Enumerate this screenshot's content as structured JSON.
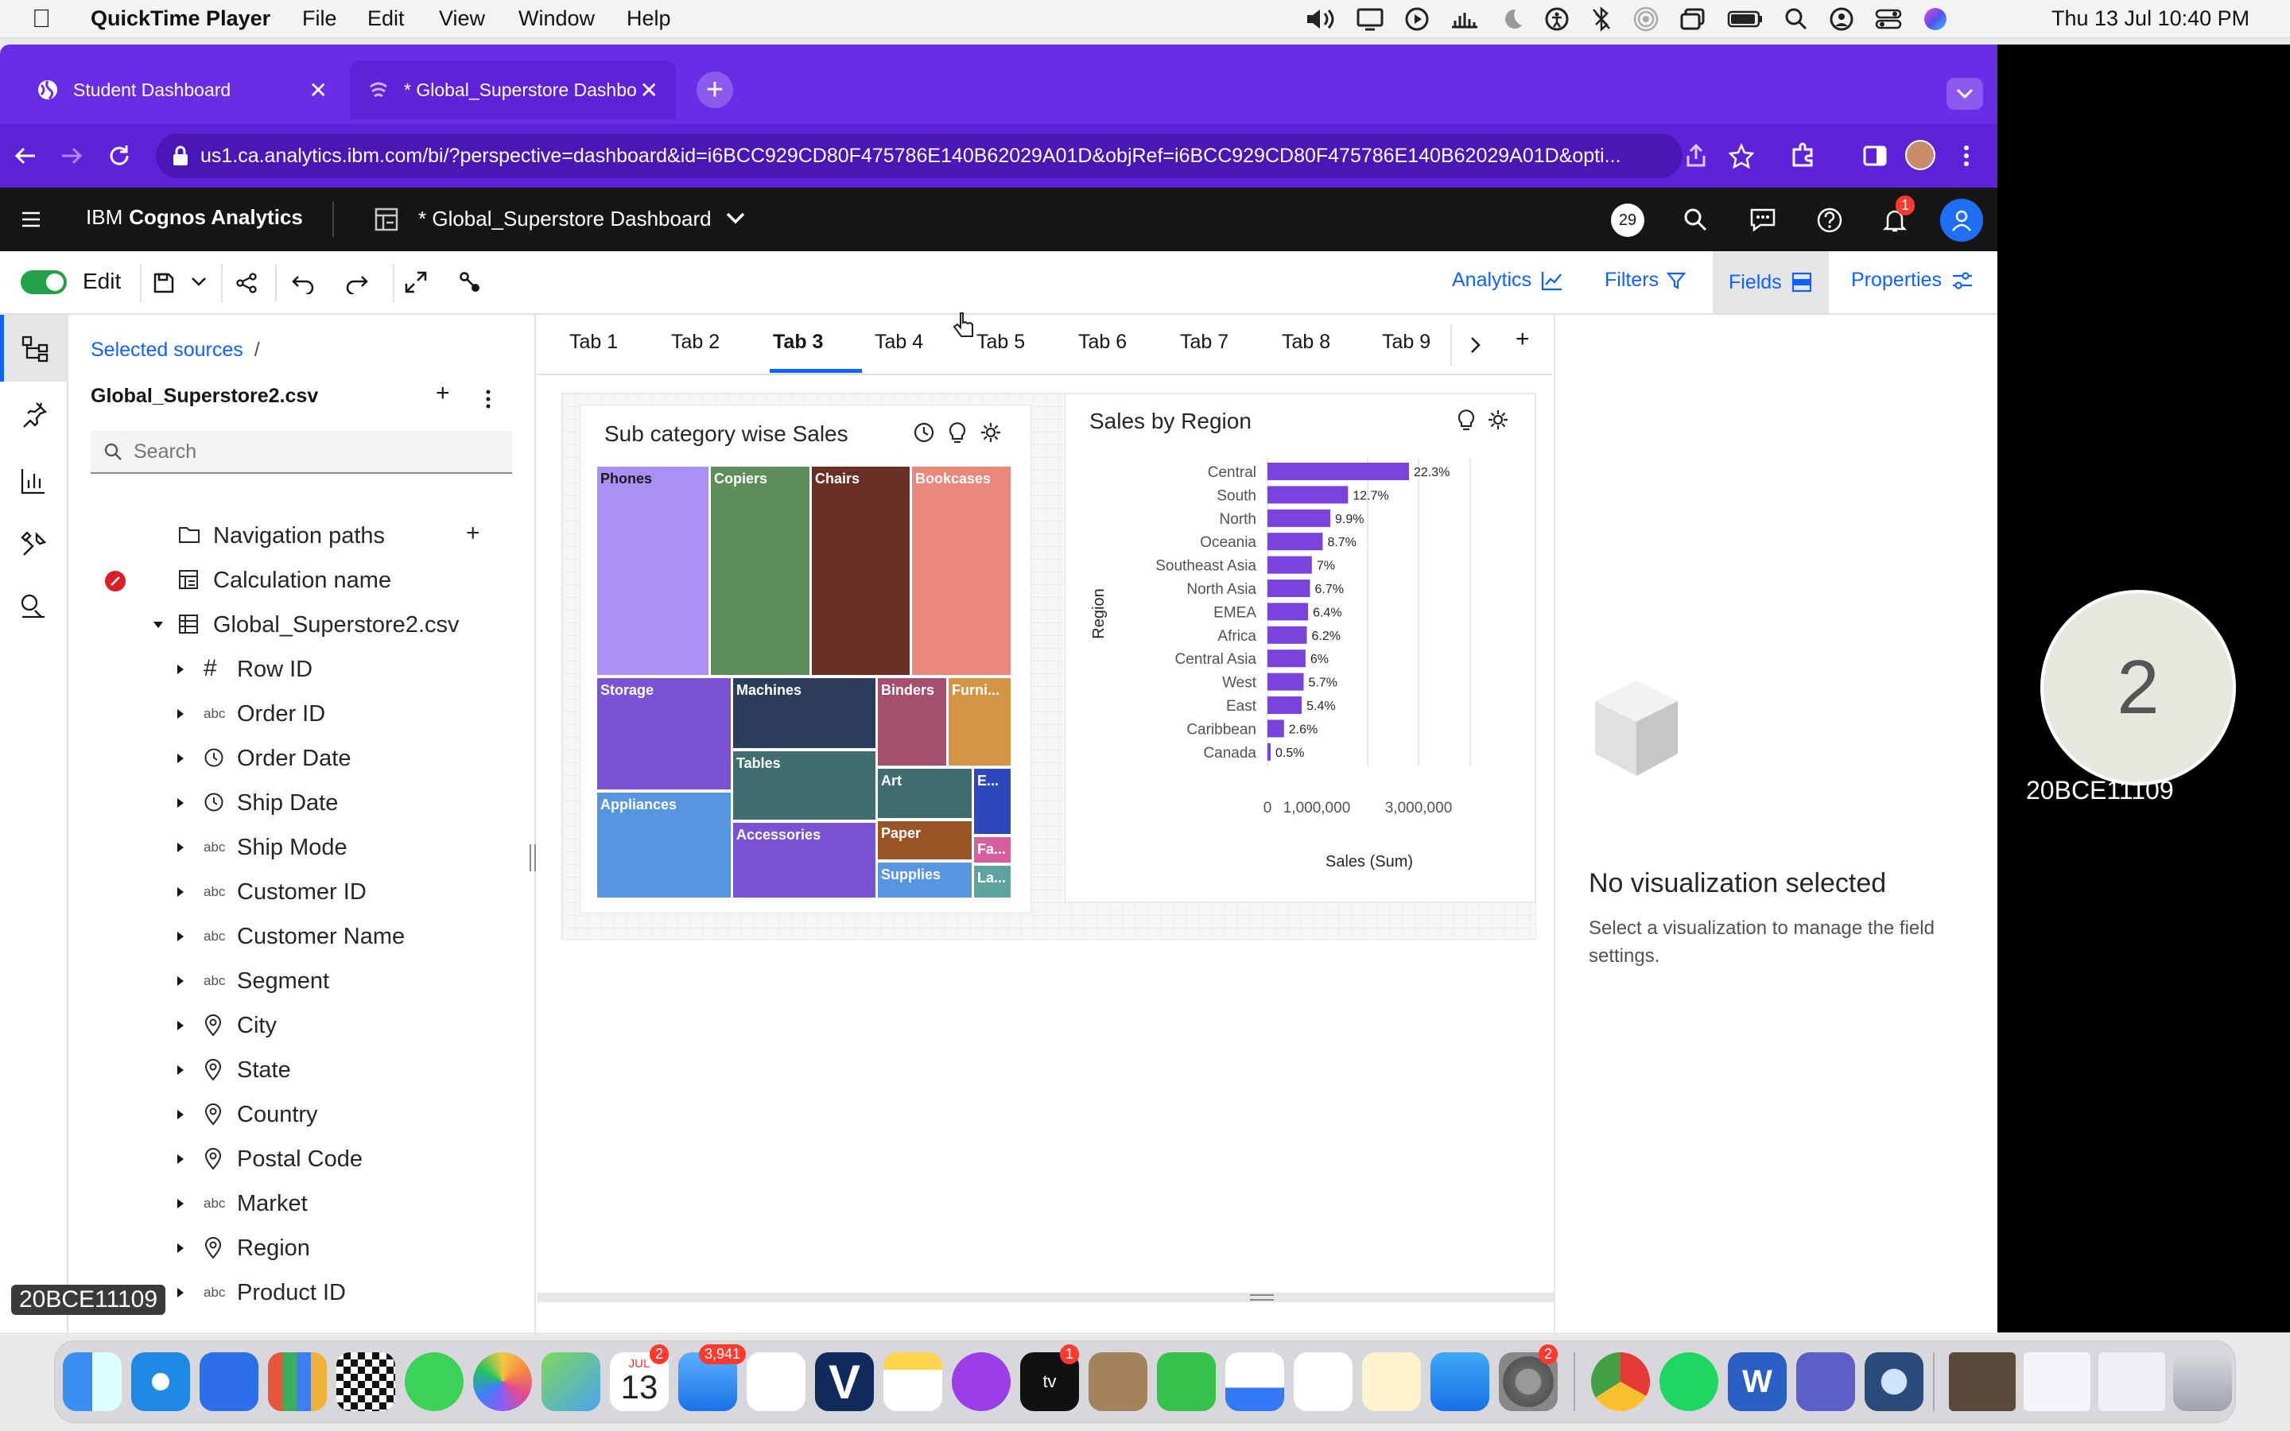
{
  "menubar": {
    "app": "QuickTime Player",
    "menus": [
      "File",
      "Edit",
      "View",
      "Window",
      "Help"
    ],
    "clock": "Thu 13 Jul  10:40 PM"
  },
  "browser": {
    "tabs": [
      {
        "title": "Student Dashboard"
      },
      {
        "title": "* Global_Superstore Dashbo"
      }
    ],
    "url": "us1.ca.analytics.ibm.com/bi/?perspective=dashboard&id=i6BCC929CD80F475786E140B62029A01D&objRef=i6BCC929CD80F475786E140B62029A01D&opti..."
  },
  "cognos": {
    "brand_prefix": "IBM",
    "brand_name": "Cognos Analytics",
    "dashboard_title": "* Global_Superstore Dashboard",
    "avatar_count": "29",
    "notif_count": "1"
  },
  "toolbar": {
    "edit_label": "Edit",
    "right_tabs": [
      "Analytics",
      "Filters",
      "Fields",
      "Properties"
    ],
    "active_right_tab": "Fields"
  },
  "datapanel": {
    "breadcrumb": "Selected sources",
    "breadcrumb_sep": "/",
    "source": "Global_Superstore2.csv",
    "search_placeholder": "Search",
    "items": [
      {
        "label": "Navigation paths",
        "type": "folder"
      },
      {
        "label": "Calculation name",
        "type": "calc"
      },
      {
        "label": "Global_Superstore2.csv",
        "type": "table"
      },
      {
        "label": "Row ID",
        "type": "hash"
      },
      {
        "label": "Order ID",
        "type": "abc"
      },
      {
        "label": "Order Date",
        "type": "clock"
      },
      {
        "label": "Ship Date",
        "type": "clock"
      },
      {
        "label": "Ship Mode",
        "type": "abc"
      },
      {
        "label": "Customer ID",
        "type": "abc"
      },
      {
        "label": "Customer Name",
        "type": "abc"
      },
      {
        "label": "Segment",
        "type": "abc"
      },
      {
        "label": "City",
        "type": "pin"
      },
      {
        "label": "State",
        "type": "pin"
      },
      {
        "label": "Country",
        "type": "pin"
      },
      {
        "label": "Postal Code",
        "type": "pin"
      },
      {
        "label": "Market",
        "type": "abc"
      },
      {
        "label": "Region",
        "type": "pin"
      },
      {
        "label": "Product ID",
        "type": "abc"
      }
    ],
    "abc": "abc",
    "hash": "#"
  },
  "canvas": {
    "tabs": [
      "Tab 1",
      "Tab 2",
      "Tab 3",
      "Tab 4",
      "Tab 5",
      "Tab 6",
      "Tab 7",
      "Tab 8",
      "Tab 9"
    ],
    "active_tab": "Tab 3"
  },
  "treemap": {
    "title": "Sub category wise Sales",
    "cells": [
      {
        "label": "Phones",
        "color": "#a990f5"
      },
      {
        "label": "Copiers",
        "color": "#5e8f5a"
      },
      {
        "label": "Chairs",
        "color": "#6b2e27"
      },
      {
        "label": "Bookcases",
        "color": "#e8877a"
      },
      {
        "label": "Storage",
        "color": "#7a52d4"
      },
      {
        "label": "Machines",
        "color": "#2c3d5c"
      },
      {
        "label": "Binders",
        "color": "#a34f6d"
      },
      {
        "label": "Furni...",
        "color": "#d49446"
      },
      {
        "label": "Appliances",
        "color": "#5895e0"
      },
      {
        "label": "Tables",
        "color": "#3f6d70"
      },
      {
        "label": "Art",
        "color": "#3f6d70"
      },
      {
        "label": "E...",
        "color": "#2f47bd"
      },
      {
        "label": "Accessories",
        "color": "#7a52d4"
      },
      {
        "label": "Paper",
        "color": "#9a5526"
      },
      {
        "label": "Fa...",
        "color": "#d45f9c"
      },
      {
        "label": "Supplies",
        "color": "#5895e0"
      },
      {
        "label": "La...",
        "color": "#5fa3a0"
      }
    ]
  },
  "chart_data": {
    "type": "bar",
    "title": "Sales by Region",
    "orientation": "horizontal",
    "categories": [
      "Central",
      "South",
      "North",
      "Oceania",
      "Southeast Asia",
      "North Asia",
      "EMEA",
      "Africa",
      "Central Asia",
      "West",
      "East",
      "Caribbean",
      "Canada"
    ],
    "values": [
      22.3,
      12.7,
      9.9,
      8.7,
      7,
      6.7,
      6.4,
      6.2,
      6,
      5.7,
      5.4,
      2.6,
      0.5
    ],
    "value_labels": [
      "22.3%",
      "12.7%",
      "9.9%",
      "8.7%",
      "7%",
      "6.7%",
      "6.4%",
      "6.2%",
      "6%",
      "5.7%",
      "5.4%",
      "2.6%",
      "0.5%"
    ],
    "xlabel": "Sales (Sum)",
    "ylabel": "Region",
    "xticks": [
      "0",
      "1,000,000",
      "3,000,000"
    ],
    "bar_color": "#7a43dc",
    "grid": true
  },
  "properties": {
    "empty_title": "No visualization selected",
    "empty_desc": "Select a visualization to manage the field settings."
  },
  "overlay": {
    "participant_number": "2",
    "participant_name": "20BCE11109",
    "watermark": "20BCE11109"
  },
  "dock": {
    "calendar_month": "JUL",
    "calendar_day": "13",
    "mail_badge": "3,941",
    "calendar_badge": "2",
    "tv_badge": "1",
    "settings_badge": "2"
  }
}
